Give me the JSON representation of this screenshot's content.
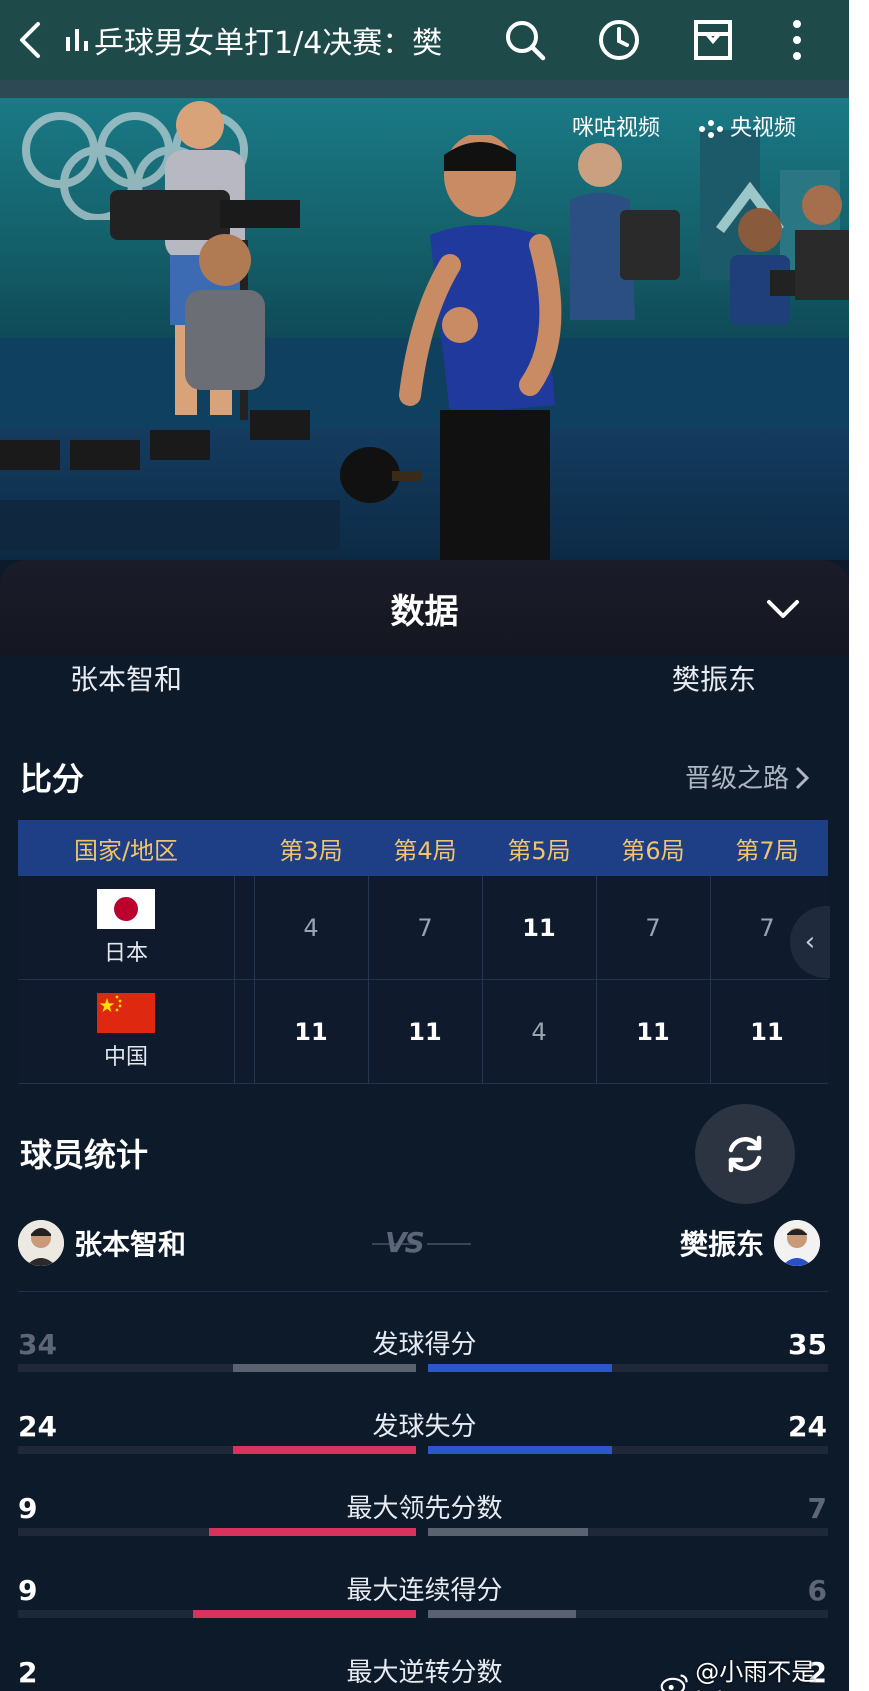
{
  "topbar": {
    "title": "乒球男女单打1/4决赛：樊",
    "icons": [
      "back-arrow-icon",
      "bar-chart-icon",
      "search-icon",
      "clock-icon",
      "inbox-icon",
      "more-vertical-icon"
    ]
  },
  "video": {
    "watermark_left": "咪咕视频",
    "watermark_right": "央视频"
  },
  "panel": {
    "title": "数据",
    "player_left": "张本智和",
    "player_right": "樊振东"
  },
  "score": {
    "section_title": "比分",
    "route_link": "晋级之路",
    "header": [
      "国家/地区",
      "第3局",
      "第4局",
      "第5局",
      "第6局",
      "第7局"
    ],
    "rows": [
      {
        "country": "日本",
        "flag": "japan",
        "scores": [
          "4",
          "7",
          "11",
          "7",
          "7"
        ],
        "win": [
          false,
          false,
          true,
          false,
          false
        ]
      },
      {
        "country": "中国",
        "flag": "china",
        "scores": [
          "11",
          "11",
          "4",
          "11",
          "11"
        ],
        "win": [
          true,
          true,
          false,
          true,
          true
        ]
      }
    ]
  },
  "player_stats": {
    "section_title": "球员统计",
    "left_player": "张本智和",
    "right_player": "樊振东",
    "vs": "VS",
    "items": [
      {
        "name": "发球得分",
        "left": "34",
        "right": "35",
        "left_frac": 0.46,
        "right_frac": 0.46,
        "left_color": "#5a6270",
        "right_color": "#2c56c9",
        "left_text": "#5e6676",
        "right_text": "#ffffff"
      },
      {
        "name": "发球失分",
        "left": "24",
        "right": "24",
        "left_frac": 0.46,
        "right_frac": 0.46,
        "left_color": "#d8335d",
        "right_color": "#2c56c9",
        "left_text": "#ffffff",
        "right_text": "#ffffff"
      },
      {
        "name": "最大领先分数",
        "left": "9",
        "right": "7",
        "left_frac": 0.52,
        "right_frac": 0.4,
        "left_color": "#d8335d",
        "right_color": "#5a6270",
        "left_text": "#ffffff",
        "right_text": "#5e6676"
      },
      {
        "name": "最大连续得分",
        "left": "9",
        "right": "6",
        "left_frac": 0.56,
        "right_frac": 0.37,
        "left_color": "#d8335d",
        "right_color": "#5a6270",
        "left_text": "#ffffff",
        "right_text": "#5e6676"
      },
      {
        "name": "最大逆转分数",
        "left": "2",
        "right": "2",
        "left_frac": 0.0,
        "right_frac": 0.0,
        "left_color": "#d8335d",
        "right_color": "#5a6270",
        "left_text": "#ffffff",
        "right_text": "#ffffff"
      }
    ]
  },
  "weibo": {
    "handle": "@小雨不是joker"
  },
  "colors": {
    "table_header_bg": "#1e3f86",
    "table_header_text": "#f0c46a",
    "page_bg": "#0d1a2a",
    "topbar_bg": "#1f4a4a"
  }
}
